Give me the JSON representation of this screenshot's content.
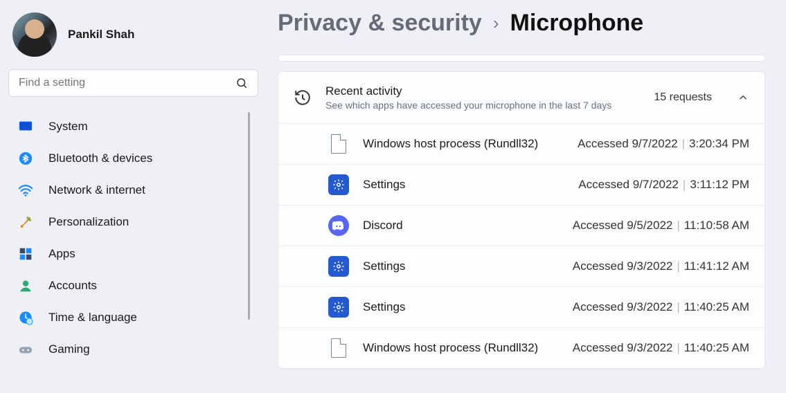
{
  "user": {
    "name": "Pankil Shah"
  },
  "search": {
    "placeholder": "Find a setting"
  },
  "nav": {
    "items": [
      {
        "label": "System",
        "icon": "monitor"
      },
      {
        "label": "Bluetooth & devices",
        "icon": "bluetooth"
      },
      {
        "label": "Network & internet",
        "icon": "wifi"
      },
      {
        "label": "Personalization",
        "icon": "brush"
      },
      {
        "label": "Apps",
        "icon": "apps"
      },
      {
        "label": "Accounts",
        "icon": "person"
      },
      {
        "label": "Time & language",
        "icon": "globe-clock"
      },
      {
        "label": "Gaming",
        "icon": "gamepad"
      }
    ]
  },
  "breadcrumb": {
    "parent": "Privacy & security",
    "sep": "›",
    "current": "Microphone"
  },
  "recent": {
    "title": "Recent activity",
    "subtitle": "See which apps have accessed your microphone in the last 7 days",
    "summary": "15 requests",
    "rows": [
      {
        "app": "Windows host process (Rundll32)",
        "icon": "file",
        "date": "Accessed 9/7/2022",
        "time": "3:20:34 PM"
      },
      {
        "app": "Settings",
        "icon": "settings",
        "date": "Accessed 9/7/2022",
        "time": "3:11:12 PM"
      },
      {
        "app": "Discord",
        "icon": "discord",
        "date": "Accessed 9/5/2022",
        "time": "11:10:58 AM"
      },
      {
        "app": "Settings",
        "icon": "settings",
        "date": "Accessed 9/3/2022",
        "time": "11:41:12 AM"
      },
      {
        "app": "Settings",
        "icon": "settings",
        "date": "Accessed 9/3/2022",
        "time": "11:40:25 AM"
      },
      {
        "app": "Windows host process (Rundll32)",
        "icon": "file",
        "date": "Accessed 9/3/2022",
        "time": "11:40:25 AM"
      }
    ]
  }
}
